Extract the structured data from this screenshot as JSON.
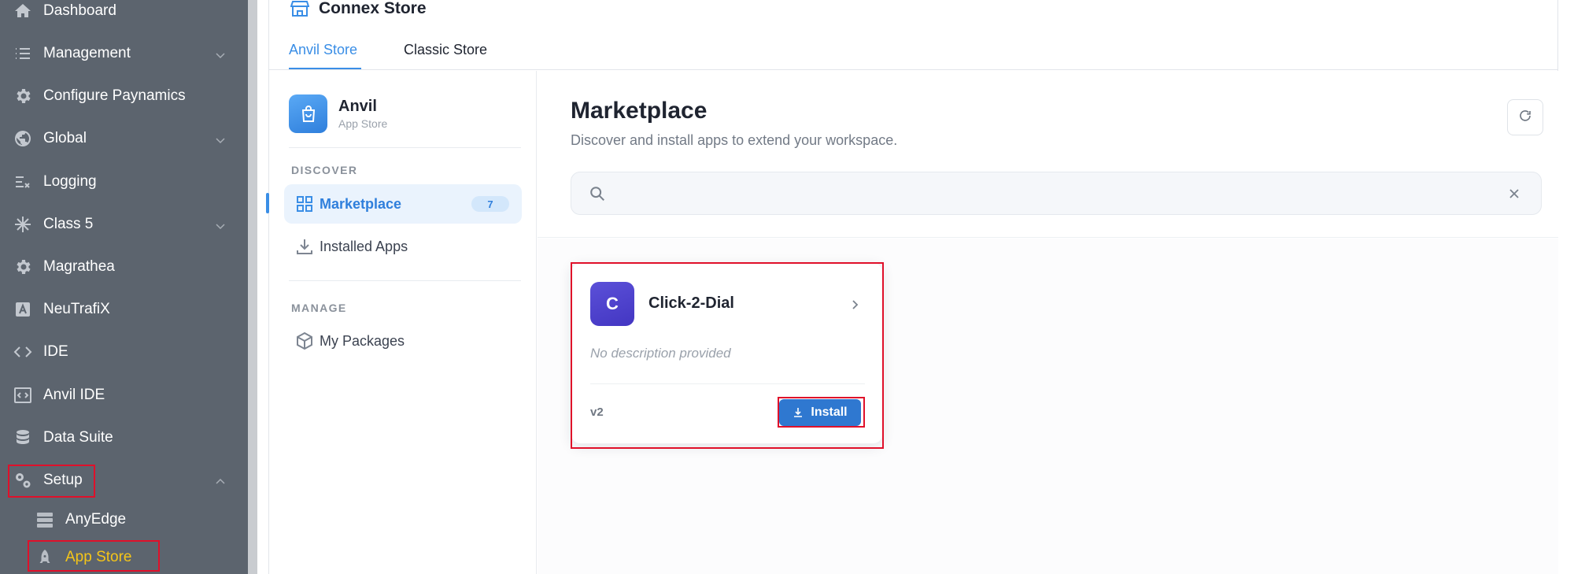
{
  "sidebar": {
    "items": [
      {
        "label": "Dashboard",
        "icon": "home-icon"
      },
      {
        "label": "Management",
        "icon": "list-icon"
      },
      {
        "label": "Configure Paynamics",
        "icon": "gear-icon"
      },
      {
        "label": "Global",
        "icon": "globe-icon"
      },
      {
        "label": "Logging",
        "icon": "log-list-icon"
      },
      {
        "label": "Class 5",
        "icon": "asterisk-icon"
      },
      {
        "label": "Magrathea",
        "icon": "gear-icon"
      },
      {
        "label": "NeuTrafiX",
        "icon": "letter-a-icon"
      },
      {
        "label": "IDE",
        "icon": "code-icon"
      },
      {
        "label": "Anvil IDE",
        "icon": "code-window-icon"
      },
      {
        "label": "Data Suite",
        "icon": "database-icon"
      },
      {
        "label": "Setup",
        "icon": "gears-icon"
      }
    ],
    "sub_items": [
      {
        "label": "AnyEdge",
        "icon": "server-icon"
      },
      {
        "label": "App Store",
        "icon": "rocket-icon"
      }
    ],
    "active_color": "#f5c518"
  },
  "header": {
    "title": "Connex Store",
    "tabs": [
      {
        "label": "Anvil Store",
        "active": true
      },
      {
        "label": "Classic Store",
        "active": false
      }
    ]
  },
  "store_nav": {
    "brand_name": "Anvil",
    "brand_sub": "App Store",
    "discover_label": "DISCOVER",
    "manage_label": "MANAGE",
    "marketplace_label": "Marketplace",
    "marketplace_count": "7",
    "installed_label": "Installed Apps",
    "packages_label": "My Packages"
  },
  "main": {
    "title": "Marketplace",
    "subtitle": "Discover and install apps to extend your workspace.",
    "search": {
      "value": "",
      "placeholder": ""
    },
    "apps": [
      {
        "initial": "C",
        "name": "Click-2-Dial",
        "description": "No description provided",
        "version": "v2",
        "install_label": "Install"
      }
    ]
  },
  "colors": {
    "accent": "#3a8ee6",
    "sidebar_bg": "#5c646e",
    "highlight": "#e0102a",
    "install_button": "#2f78d0"
  }
}
